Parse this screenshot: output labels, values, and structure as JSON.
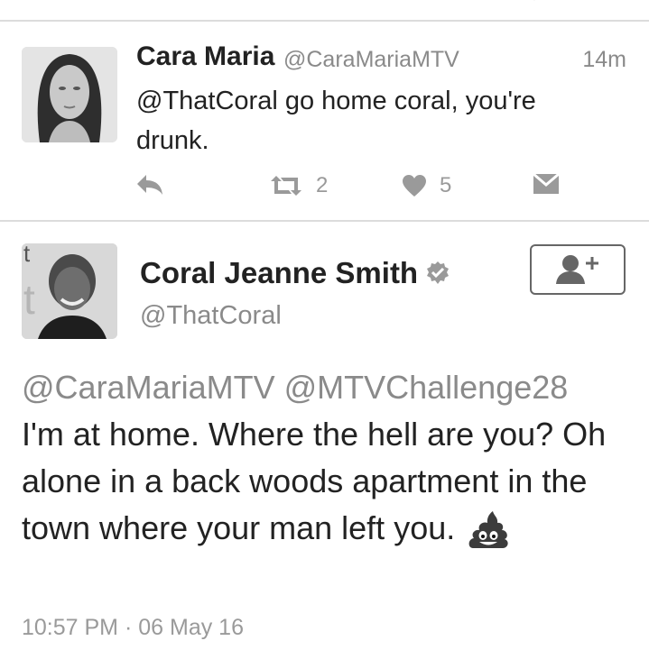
{
  "reply_tweet": {
    "display_name": "Cara Maria",
    "handle": "@CaraMariaMTV",
    "time": "14m",
    "text": "@ThatCoral go home coral, you're drunk.",
    "retweet_count": "2",
    "like_count": "5",
    "icons": [
      "reply-icon",
      "retweet-icon",
      "heart-icon",
      "message-icon"
    ]
  },
  "main_tweet": {
    "display_name": "Coral Jeanne Smith",
    "handle": "@ThatCoral",
    "mentions": "@CaraMariaMTV @MTVChallenge28",
    "text": "I'm at home. Where the hell are you? Oh alone in a back woods apartment in the town where your man left you.",
    "emoji": "pile-of-poo-icon",
    "time": "10:57 PM",
    "separator": "·",
    "date": "06 May 16",
    "icons": [
      "verified-badge-icon",
      "follow-user-icon"
    ]
  },
  "colors": {
    "text": "#222222",
    "secondary": "#8a8a8a",
    "divider": "#dcdcdc"
  }
}
